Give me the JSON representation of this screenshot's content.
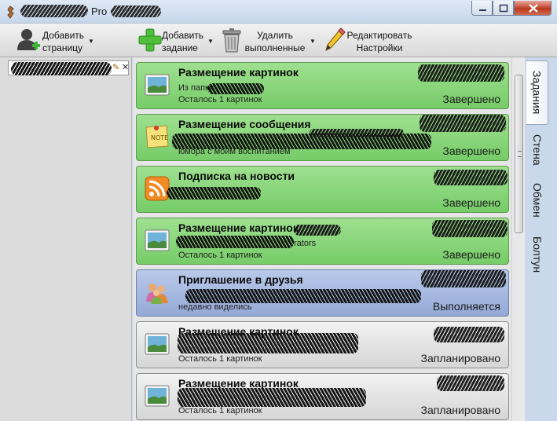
{
  "window": {
    "title_suffix": "Pro",
    "controls": {
      "minimize": "minimize",
      "maximize": "maximize",
      "close": "close"
    }
  },
  "toolbar": {
    "add_page": {
      "label": "Добавить\nстраницу",
      "icon": "person-add-icon"
    },
    "add_task": {
      "label": "Добавить\nзадание",
      "icon": "green-plus-icon"
    },
    "delete_done": {
      "label": "Удалить\nвыполненные",
      "icon": "trash-icon"
    },
    "edit_settings": {
      "label": "Редактировать\nНастройки",
      "icon": "pencil-icon"
    }
  },
  "tasks": [
    {
      "title": "Размещение картинок",
      "line1": "Из папки",
      "line2": "Осталось 1 картинок",
      "status": "Завершено",
      "state": "done",
      "icon": "picture-icon"
    },
    {
      "title": "Размещение сообщения",
      "line1": "",
      "line2": "юмора с моим воспитанием",
      "status": "Завершено",
      "state": "done",
      "icon": "note-icon"
    },
    {
      "title": "Подписка на новости",
      "line1": "",
      "line2": "",
      "status": "Завершено",
      "state": "done",
      "icon": "rss-icon"
    },
    {
      "title": "Размещение картинок",
      "line1": "rators",
      "line2": "Осталось 1 картинок",
      "status": "Завершено",
      "state": "done",
      "icon": "picture-icon"
    },
    {
      "title": "Приглашение в друзья",
      "line1": "",
      "line2": "недавно виделись",
      "status": "Выполняется",
      "state": "run",
      "icon": "friends-icon"
    },
    {
      "title": "Размещение картинок",
      "line1": "",
      "line2": "Осталось 1 картинок",
      "status": "Запланировано",
      "state": "plan",
      "icon": "picture-icon"
    },
    {
      "title": "Размещение картинок",
      "line1": "",
      "line2": "Осталось 1 картинок",
      "status": "Запланировано",
      "state": "plan",
      "icon": "picture-icon"
    }
  ],
  "side_tabs": [
    "Задания",
    "Стена",
    "Обмен",
    "Болтун"
  ],
  "colors": {
    "done": "#7fd070",
    "running": "#a3b6de",
    "planned": "#e0e0e0"
  }
}
